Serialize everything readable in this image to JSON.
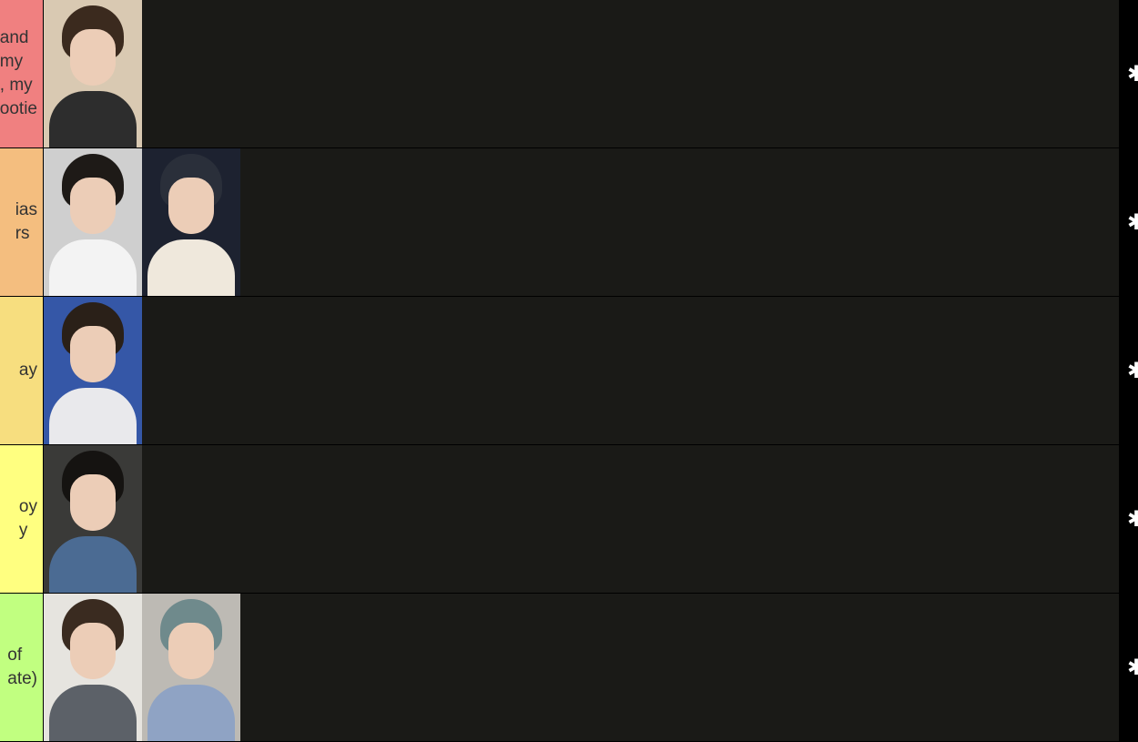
{
  "tiers": [
    {
      "label": "and\nmy\n, my\nootie",
      "color": "#f08080"
    },
    {
      "label": "ias\nrs",
      "color": "#f4be7f"
    },
    {
      "label": "ay",
      "color": "#f7de7f"
    },
    {
      "label": "oy\ny",
      "color": "#ffff80"
    },
    {
      "label": "of\nate)",
      "color": "#c1ff80"
    }
  ],
  "photos": [
    {
      "icon": "selfie-photo",
      "bg": "#d9c9b2",
      "hair": "#3b2a1e",
      "body": "#2d2d2d"
    },
    {
      "icon": "selfie-photo",
      "bg": "#cfcfcf",
      "hair": "#1e1a17",
      "body": "#f3f3f3"
    },
    {
      "icon": "selfie-photo",
      "bg": "#1d2230",
      "hair": "#2a2f3a",
      "body": "#efe8dc"
    },
    {
      "icon": "selfie-photo",
      "bg": "#3557a7",
      "hair": "#2a2018",
      "body": "#e9e9ec"
    },
    {
      "icon": "selfie-photo",
      "bg": "#3a3a38",
      "hair": "#151311",
      "body": "#4b6b93"
    },
    {
      "icon": "selfie-photo",
      "bg": "#e6e4df",
      "hair": "#3a2b20",
      "body": "#5c6168"
    },
    {
      "icon": "selfie-photo",
      "bg": "#bdbab4",
      "hair": "#6f8a8c",
      "body": "#8fa3c4"
    }
  ],
  "settings_icon": "gear-icon",
  "settings_glyph": "✱"
}
